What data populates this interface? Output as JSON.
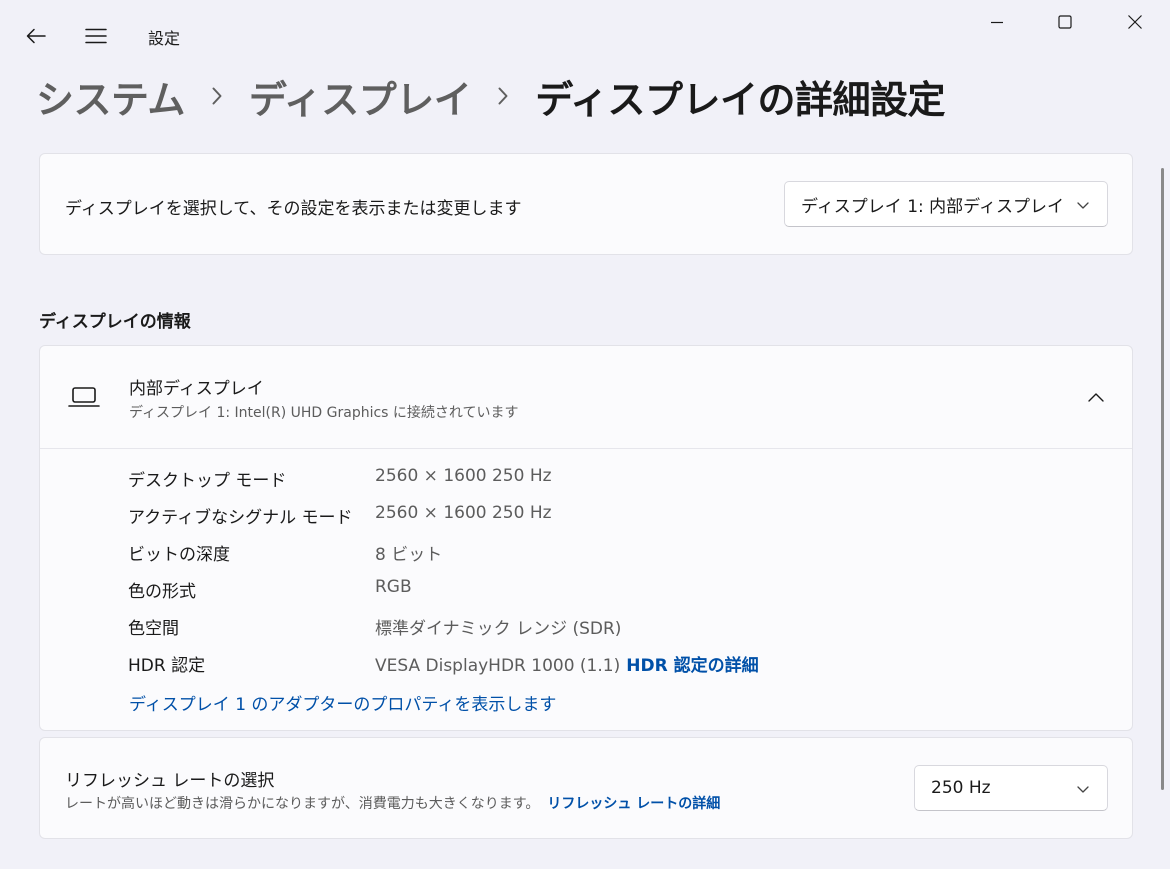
{
  "window": {
    "app_title": "設定"
  },
  "breadcrumb": {
    "items": [
      "システム",
      "ディスプレイ",
      "ディスプレイの詳細設定"
    ]
  },
  "display_select": {
    "label": "ディスプレイを選択して、その設定を表示または変更します",
    "selected": "ディスプレイ 1: 内部ディスプレイ"
  },
  "info_section": {
    "title": "ディスプレイの情報",
    "display_name": "内部ディスプレイ",
    "display_subtitle": "ディスプレイ 1: Intel(R) UHD Graphics に接続されています",
    "rows": [
      {
        "key": "デスクトップ モード",
        "value": "2560 × 1600 250 Hz"
      },
      {
        "key": "アクティブなシグナル モード",
        "value": "2560 × 1600 250 Hz"
      },
      {
        "key": "ビットの深度",
        "value": "8 ビット"
      },
      {
        "key": "色の形式",
        "value": "RGB"
      },
      {
        "key": "色空間",
        "value": "標準ダイナミック レンジ (SDR)"
      },
      {
        "key": "HDR 認定",
        "value": "VESA DisplayHDR 1000 (1.1)"
      }
    ],
    "hdr_link": "HDR 認定の詳細",
    "adapter_link": "ディスプレイ 1 のアダプターのプロパティを表示します"
  },
  "refresh": {
    "title": "リフレッシュ レートの選択",
    "description": "レートが高いほど動きは滑らかになりますが、消費電力も大きくなります。",
    "link": "リフレッシュ レートの詳細",
    "selected": "250 Hz"
  },
  "colors": {
    "background": "#f1f1f8",
    "card": "#fbfbfd",
    "accent_link": "#0050a8"
  },
  "icons": [
    "back-arrow-icon",
    "hamburger-menu-icon",
    "minimize-icon",
    "maximize-icon",
    "close-icon",
    "chevron-right-icon",
    "chevron-down-icon",
    "chevron-up-icon",
    "laptop-icon"
  ]
}
